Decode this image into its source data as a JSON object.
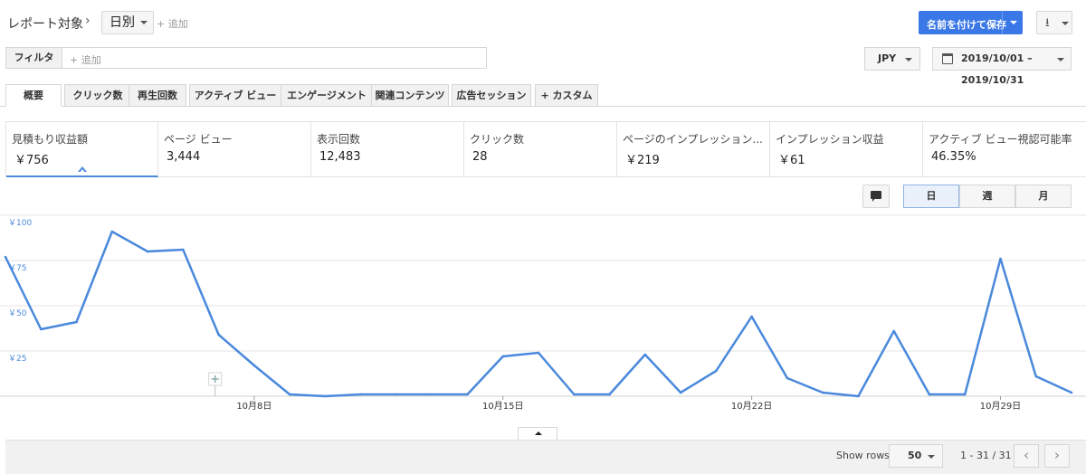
{
  "header": {
    "report_label": "レポート対象",
    "chevron": "›",
    "dimension": "日別",
    "add": "+ 追加",
    "save_label": "名前を付けて保存",
    "download_icon": "⭳"
  },
  "filter": {
    "label": "フィルタ",
    "add": "+ 追加"
  },
  "currency": "JPY",
  "date_range": "2019/10/01 – 2019/10/31",
  "tabs": [
    "概要",
    "クリック数",
    "再生回数",
    "アクティブ ビュー",
    "エンゲージメント",
    "関連コンテンツ",
    "広告セッション",
    "+ カスタム"
  ],
  "metrics": [
    {
      "name": "見積もり収益額",
      "value": "￥756"
    },
    {
      "name": "ページ ビュー",
      "value": "3,444"
    },
    {
      "name": "表示回数",
      "value": "12,483"
    },
    {
      "name": "クリック数",
      "value": "28"
    },
    {
      "name": "ページのインプレッション...",
      "value": "￥219"
    },
    {
      "name": "インプレッション収益",
      "value": "￥61"
    },
    {
      "name": "アクティブ ビュー視認可能率",
      "value": "46.35%"
    }
  ],
  "granularity": [
    "日",
    "週",
    "月"
  ],
  "chart_data": {
    "type": "line",
    "x": [
      "10/1",
      "10/2",
      "10/3",
      "10/4",
      "10/5",
      "10/6",
      "10/7",
      "10/8",
      "10/9",
      "10/10",
      "10/11",
      "10/12",
      "10/13",
      "10/14",
      "10/15",
      "10/16",
      "10/17",
      "10/18",
      "10/19",
      "10/20",
      "10/21",
      "10/22",
      "10/23",
      "10/24",
      "10/25",
      "10/26",
      "10/27",
      "10/28",
      "10/29",
      "10/30",
      "10/31"
    ],
    "series": [
      {
        "values": [
          77,
          37,
          41,
          91,
          80,
          81,
          34,
          17,
          1,
          0,
          1,
          1,
          1,
          1,
          22,
          24,
          1,
          1,
          23,
          2,
          14,
          44,
          10,
          2,
          0,
          36,
          1,
          1,
          76,
          11,
          2
        ]
      }
    ],
    "y_ticks": [
      "￥25",
      "￥50",
      "￥75",
      "￥100"
    ],
    "ylim": [
      0,
      100
    ],
    "x_ticks": [
      {
        "label": "10月8日",
        "index": 7
      },
      {
        "label": "10月15日",
        "index": 14
      },
      {
        "label": "10月22日",
        "index": 21
      },
      {
        "label": "10月29日",
        "index": 28
      }
    ],
    "grid": true,
    "color": "#4a89dc"
  },
  "footer": {
    "show_rows": "Show rows",
    "rows_value": "50",
    "range": "1 - 31 / 31",
    "prev": "‹",
    "next": "›"
  }
}
